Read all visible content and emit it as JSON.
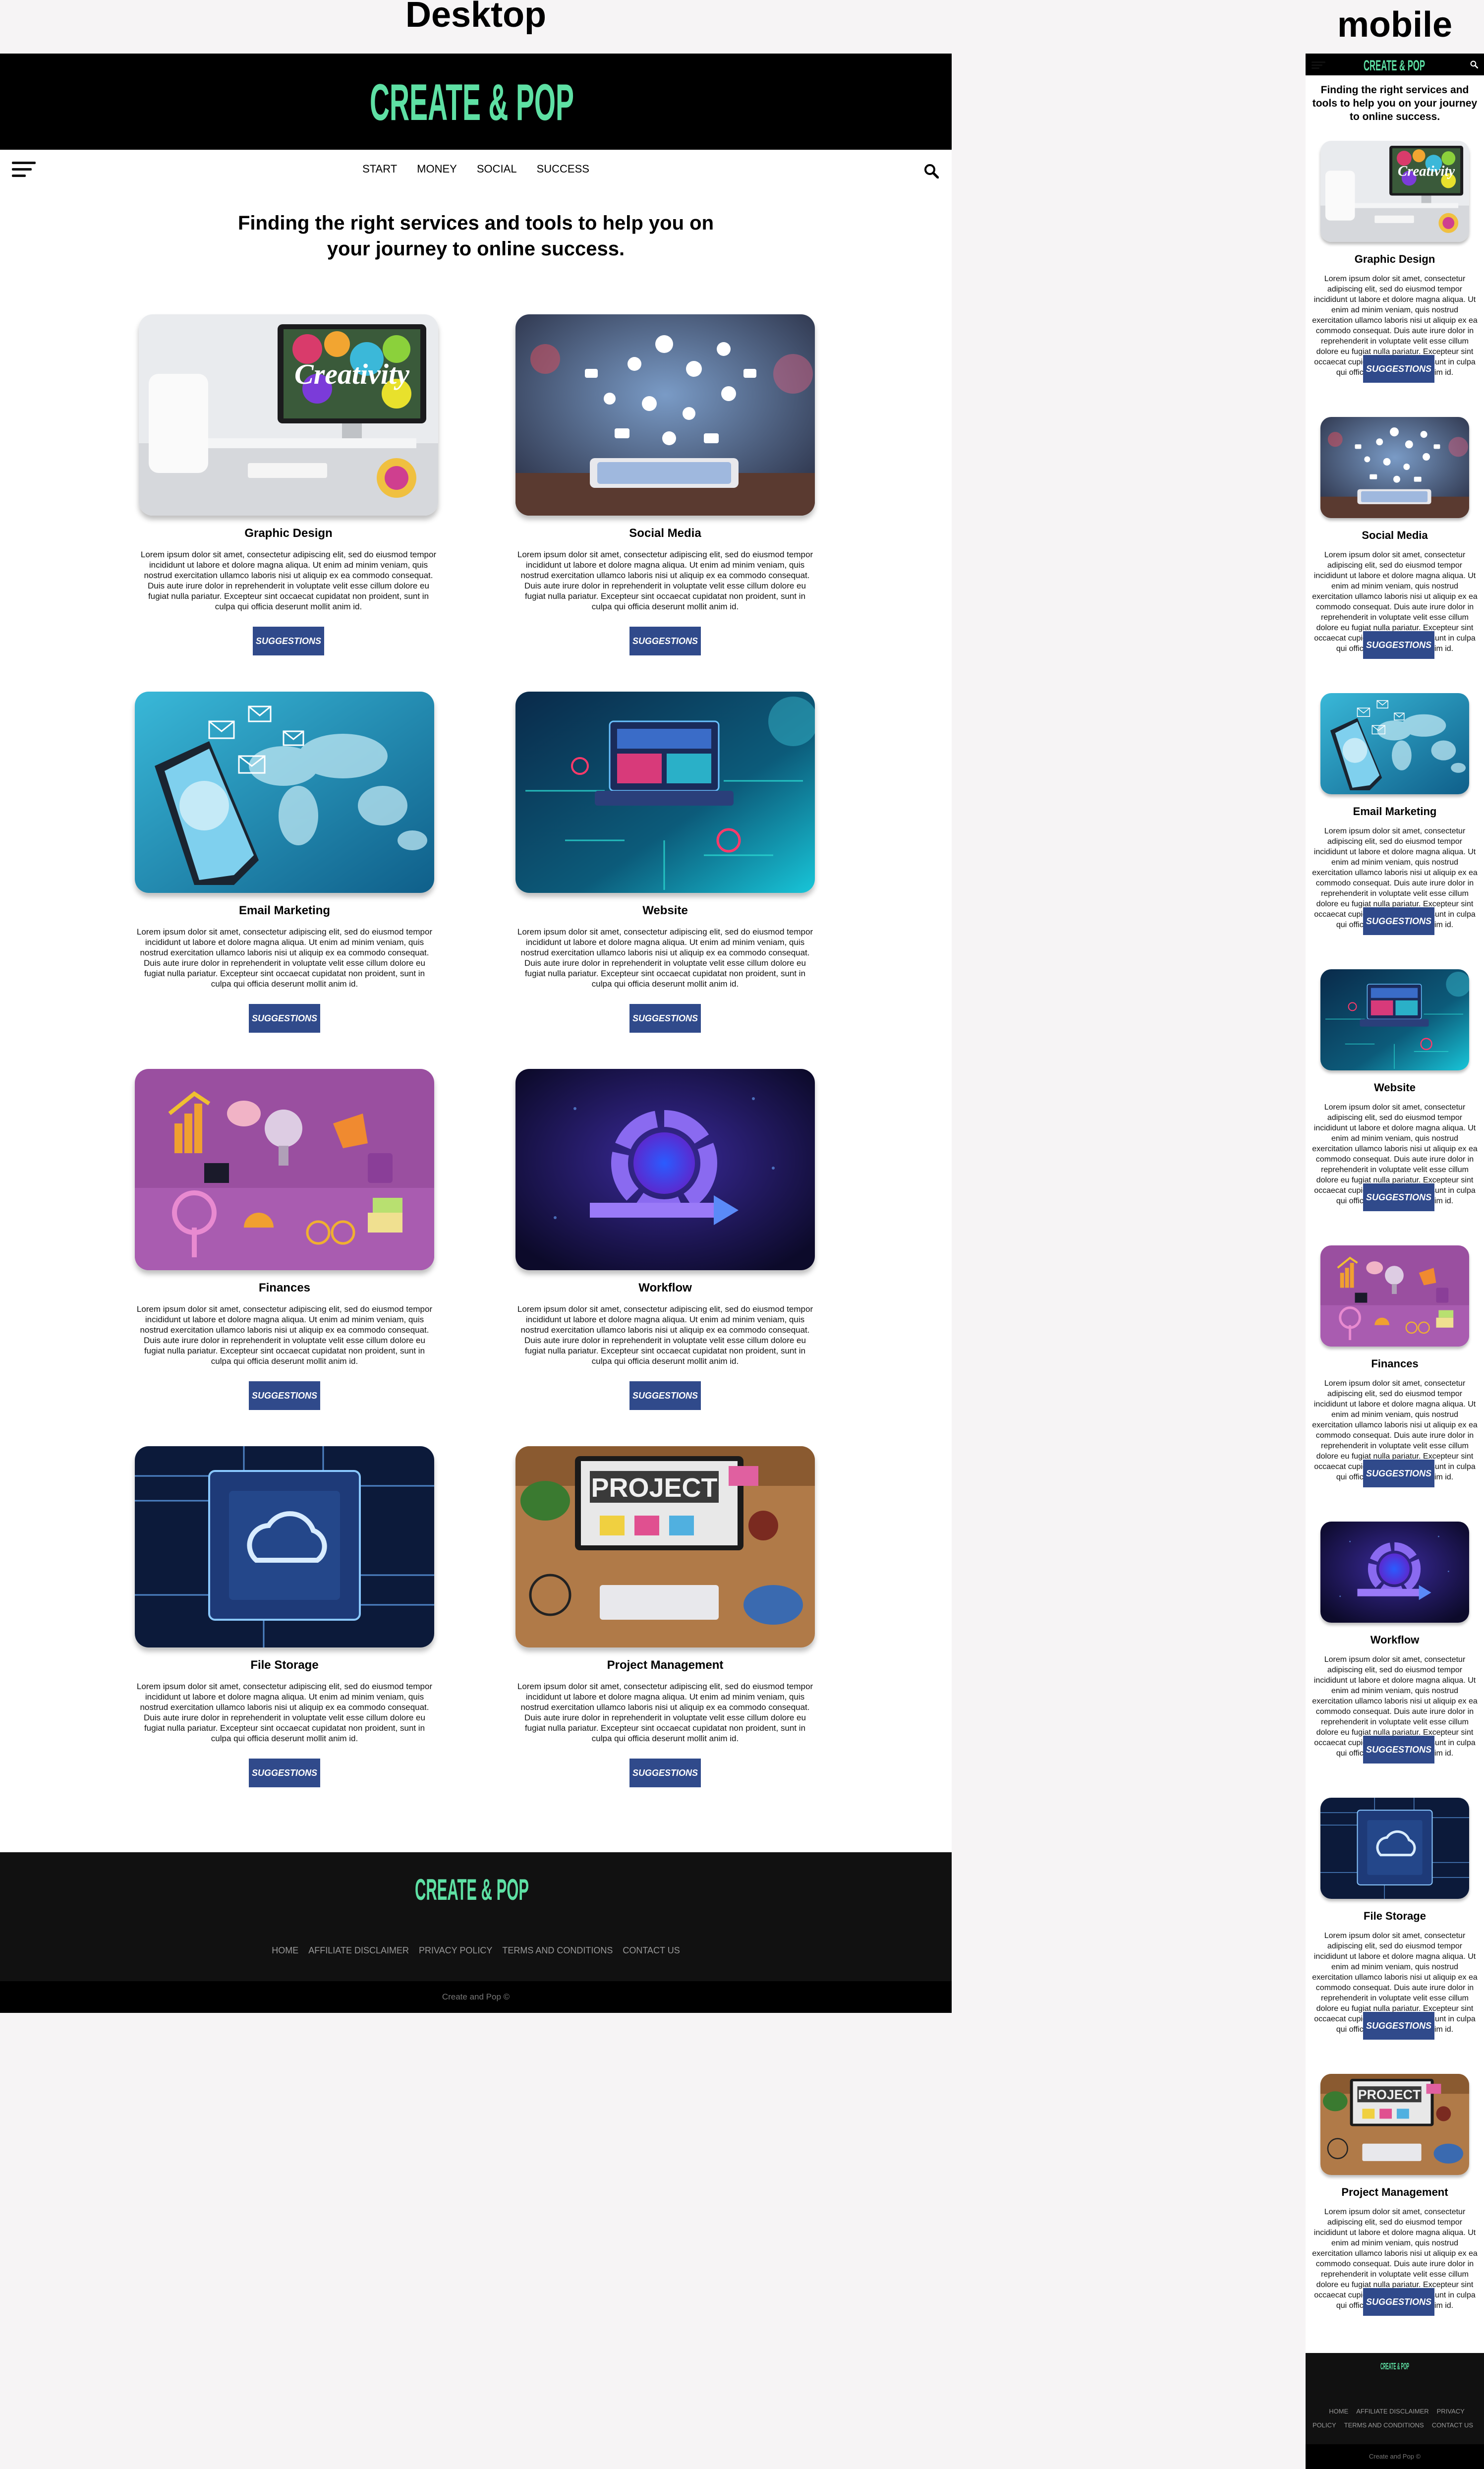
{
  "labels": {
    "desktop": "Desktop",
    "mobile": "mobile"
  },
  "brand": {
    "logo_text": "CREATE & POP",
    "logo_color": "#5ee0a4"
  },
  "nav": {
    "items": [
      "START",
      "MONEY",
      "SOCIAL",
      "SUCCESS"
    ]
  },
  "headline": "Finding the right services and tools to help you on your journey to online success.",
  "button_label": "SUGGESTIONS",
  "button_color": "#304a8b",
  "cards": [
    {
      "title": "Graphic Design",
      "image": "creativity-desk-image",
      "body": "Lorem ipsum dolor sit amet, consectetur adipiscing elit, sed do eiusmod tempor incididunt ut labore et dolore magna aliqua. Ut enim ad minim veniam, quis nostrud exercitation ullamco laboris nisi ut aliquip ex ea commodo consequat. Duis aute irure dolor in reprehenderit in voluptate velit esse cillum dolore eu fugiat nulla pariatur. Excepteur sint occaecat cupidatat non proident, sunt in culpa qui officia deserunt mollit anim id."
    },
    {
      "title": "Social Media",
      "image": "social-phone-image",
      "body": "Lorem ipsum dolor sit amet, consectetur adipiscing elit, sed do eiusmod tempor incididunt ut labore et dolore magna aliqua. Ut enim ad minim veniam, quis nostrud exercitation ullamco laboris nisi ut aliquip ex ea commodo consequat. Duis aute irure dolor in reprehenderit in voluptate velit esse cillum dolore eu fugiat nulla pariatur. Excepteur sint occaecat cupidatat non proident, sunt in culpa qui officia deserunt mollit anim id."
    },
    {
      "title": "Email Marketing",
      "image": "email-map-image",
      "body": "Lorem ipsum dolor sit amet, consectetur adipiscing elit, sed do eiusmod tempor incididunt ut labore et dolore magna aliqua. Ut enim ad minim veniam, quis nostrud exercitation ullamco laboris nisi ut aliquip ex ea commodo consequat. Duis aute irure dolor in reprehenderit in voluptate velit esse cillum dolore eu fugiat nulla pariatur. Excepteur sint occaecat cupidatat non proident, sunt in culpa qui officia deserunt mollit anim id."
    },
    {
      "title": "Website",
      "image": "website-laptop-image",
      "body": "Lorem ipsum dolor sit amet, consectetur adipiscing elit, sed do eiusmod tempor incididunt ut labore et dolore magna aliqua. Ut enim ad minim veniam, quis nostrud exercitation ullamco laboris nisi ut aliquip ex ea commodo consequat. Duis aute irure dolor in reprehenderit in voluptate velit esse cillum dolore eu fugiat nulla pariatur. Excepteur sint occaecat cupidatat non proident, sunt in culpa qui officia deserunt mollit anim id."
    },
    {
      "title": "Finances",
      "image": "finance-objects-image",
      "body": "Lorem ipsum dolor sit amet, consectetur adipiscing elit, sed do eiusmod tempor incididunt ut labore et dolore magna aliqua. Ut enim ad minim veniam, quis nostrud exercitation ullamco laboris nisi ut aliquip ex ea commodo consequat. Duis aute irure dolor in reprehenderit in voluptate velit esse cillum dolore eu fugiat nulla pariatur. Excepteur sint occaecat cupidatat non proident, sunt in culpa qui officia deserunt mollit anim id."
    },
    {
      "title": "Workflow",
      "image": "workflow-cycle-image",
      "body": "Lorem ipsum dolor sit amet, consectetur adipiscing elit, sed do eiusmod tempor incididunt ut labore et dolore magna aliqua. Ut enim ad minim veniam, quis nostrud exercitation ullamco laboris nisi ut aliquip ex ea commodo consequat. Duis aute irure dolor in reprehenderit in voluptate velit esse cillum dolore eu fugiat nulla pariatur. Excepteur sint occaecat cupidatat non proident, sunt in culpa qui officia deserunt mollit anim id."
    },
    {
      "title": "File Storage",
      "image": "cloud-chip-image",
      "body": "Lorem ipsum dolor sit amet, consectetur adipiscing elit, sed do eiusmod tempor incididunt ut labore et dolore magna aliqua. Ut enim ad minim veniam, quis nostrud exercitation ullamco laboris nisi ut aliquip ex ea commodo consequat. Duis aute irure dolor in reprehenderit in voluptate velit esse cillum dolore eu fugiat nulla pariatur. Excepteur sint occaecat cupidatat non proident, sunt in culpa qui officia deserunt mollit anim id."
    },
    {
      "title": "Project Management",
      "image": "project-desk-image",
      "body": "Lorem ipsum dolor sit amet, consectetur adipiscing elit, sed do eiusmod tempor incididunt ut labore et dolore magna aliqua. Ut enim ad minim veniam, quis nostrud exercitation ullamco laboris nisi ut aliquip ex ea commodo consequat. Duis aute irure dolor in reprehenderit in voluptate velit esse cillum dolore eu fugiat nulla pariatur. Excepteur sint occaecat cupidatat non proident, sunt in culpa qui officia deserunt mollit anim id."
    }
  ],
  "image_text": {
    "creativity": "Creativity",
    "project": "PROJECT"
  },
  "footer": {
    "links": [
      "HOME",
      "AFFILIATE DISCLAIMER",
      "PRIVACY POLICY",
      "TERMS AND CONDITIONS",
      "CONTACT US"
    ],
    "copyright": "Create and Pop ©"
  },
  "icons": {
    "menu": "hamburger-menu-icon",
    "search": "search-icon"
  }
}
